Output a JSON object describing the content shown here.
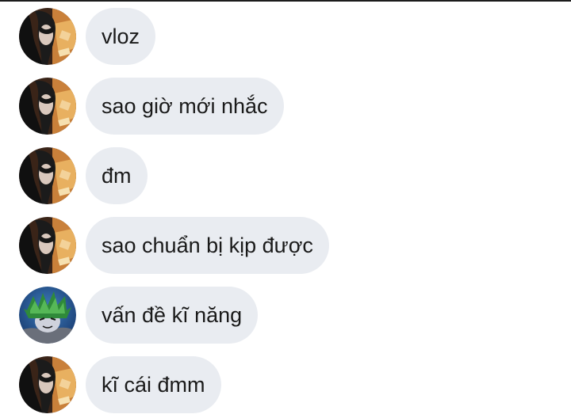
{
  "colors": {
    "bubble_background": "#e9ecf1",
    "message_text": "#1a1a1a",
    "page_background": "#ffffff"
  },
  "messages": [
    {
      "sender_avatar": "dark-haired-character-avatar",
      "text": "vloz"
    },
    {
      "sender_avatar": "dark-haired-character-avatar",
      "text": "sao giờ mới nhắc"
    },
    {
      "sender_avatar": "dark-haired-character-avatar",
      "text": "đm"
    },
    {
      "sender_avatar": "dark-haired-character-avatar",
      "text": "sao chuẩn bị kịp được"
    },
    {
      "sender_avatar": "green-haired-character-avatar",
      "text": "vấn đề kĩ năng"
    },
    {
      "sender_avatar": "dark-haired-character-avatar",
      "text": "kĩ cái đmm"
    }
  ]
}
